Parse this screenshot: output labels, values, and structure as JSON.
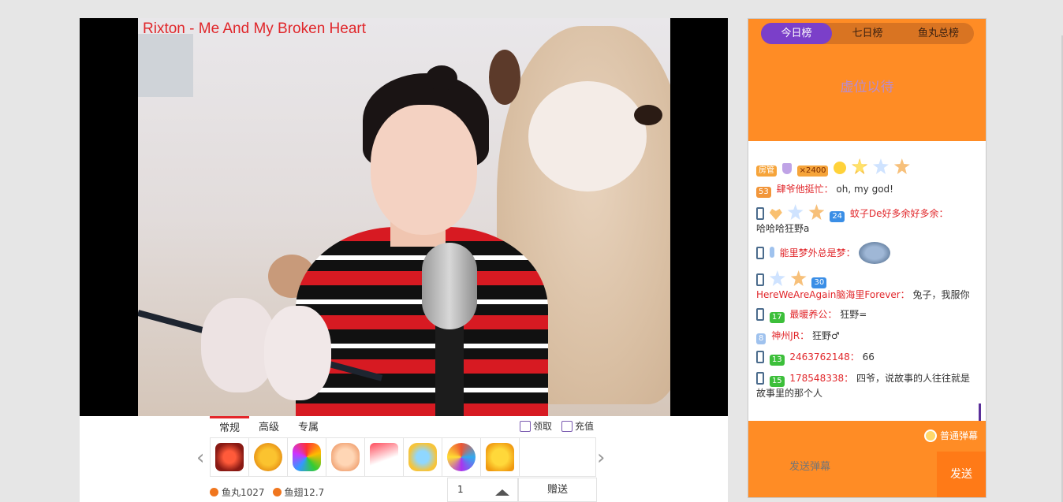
{
  "video": {
    "song_title": "Rixton - Me And My Broken Heart"
  },
  "gift_panel": {
    "tabs": [
      "常规",
      "高级",
      "专属"
    ],
    "actions": {
      "claim": "领取",
      "recharge": "充值"
    },
    "gifts": [
      {
        "icon": "diamond-shield-gift-icon"
      },
      {
        "icon": "gold-coin-gift-icon"
      },
      {
        "icon": "zan-burst-gift-icon"
      },
      {
        "icon": "clap-hands-gift-icon"
      },
      {
        "icon": "phone-gift-icon"
      },
      {
        "icon": "magic-wand-gift-icon"
      },
      {
        "icon": "flower-bouquet-gift-icon"
      },
      {
        "icon": "crown-gift-icon"
      }
    ],
    "balance_yuwan": "鱼丸1027",
    "balance_yuchi": "鱼翅12.7",
    "quantity": "1",
    "send_label": "赠送"
  },
  "sidebar": {
    "rank_tabs": [
      "今日榜",
      "七日榜",
      "鱼丸总榜"
    ],
    "rank_active": "今日榜",
    "rank_empty": "虚位以待",
    "messages": [
      {
        "badges": [
          "房管",
          "×2400"
        ],
        "user": "",
        "text": ""
      },
      {
        "level": "53",
        "user": "肆爷他挺忙：",
        "text": "oh, my god!"
      },
      {
        "level": "24",
        "user": "蚊子De好多余好多余：",
        "text": "哈哈哈狂野a"
      },
      {
        "level": "",
        "user": "能里梦外总是梦：",
        "text": ""
      },
      {
        "level": "30",
        "user": "HereWeAreAgain脑海里Forever：",
        "text": "兔子，我服你"
      },
      {
        "level": "17",
        "user": "最暖养公：",
        "text": "狂野="
      },
      {
        "level": "8",
        "user": "神州JR：",
        "text": "狂野♂"
      },
      {
        "level": "13",
        "user": "2463762148：",
        "text": "66"
      },
      {
        "level": "15",
        "user": "178548338：",
        "text": "四爷，说故事的人往往就是故事里的那个人"
      }
    ],
    "danmu_toggle": "普通弹幕",
    "input_placeholder": "发送弹幕",
    "send_label": "发送"
  },
  "colors": {
    "accent": "#ff8c25",
    "purple": "#7b3fc9",
    "red": "#e1262a"
  }
}
